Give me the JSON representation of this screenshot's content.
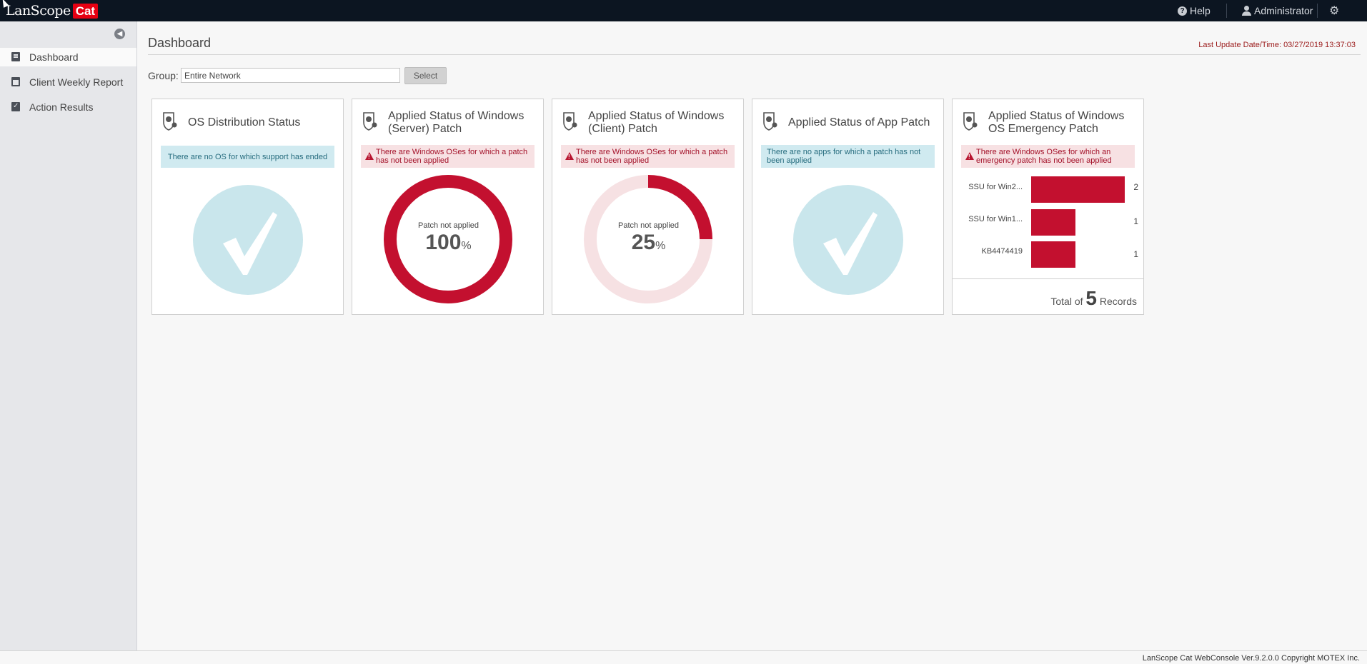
{
  "app": {
    "logo_text": "LanScope",
    "logo_badge": "Cat"
  },
  "topbar": {
    "help_label": "Help",
    "user_label": "Administrator",
    "icons": [
      "help-icon",
      "user-icon",
      "settings-icon"
    ]
  },
  "sidebar": {
    "items": [
      {
        "label": "Dashboard",
        "icon": "dashboard-icon",
        "active": true
      },
      {
        "label": "Client Weekly Report",
        "icon": "calendar-icon",
        "active": false
      },
      {
        "label": "Action Results",
        "icon": "clipboard-check-icon",
        "active": false
      }
    ]
  },
  "page": {
    "title": "Dashboard",
    "last_update": "Last Update Date/Time: 03/27/2019 13:37:03",
    "group_label": "Group:",
    "group_value": "Entire Network",
    "select_label": "Select"
  },
  "cards": [
    {
      "title": "OS Distribution Status",
      "alert": "There are no OS for which support has ended",
      "alert_type": "info"
    },
    {
      "title": "Applied Status of Windows (Server) Patch",
      "alert": "There are Windows OSes for which a patch has not been applied",
      "alert_type": "warning",
      "donut_label": "Patch not applied",
      "donut_value": "100",
      "donut_unit": "%",
      "donut_fraction": 1.0
    },
    {
      "title": "Applied Status of Windows (Client) Patch",
      "alert": "There are Windows OSes for which a patch has not been applied",
      "alert_type": "warning",
      "donut_label": "Patch not applied",
      "donut_value": "25",
      "donut_unit": "%",
      "donut_fraction": 0.25
    },
    {
      "title": "Applied Status of App Patch",
      "alert": "There are no apps for which a patch has not been applied",
      "alert_type": "info"
    },
    {
      "title": "Applied Status of Windows OS Emergency Patch",
      "alert": "There are Windows OSes for which an emergency patch has not been applied",
      "alert_type": "warning",
      "bars": [
        {
          "label": "SSU for Win2...",
          "value": 2
        },
        {
          "label": "SSU for Win1...",
          "value": 1
        },
        {
          "label": "KB4474419",
          "value": 1
        }
      ],
      "total_prefix": "Total of",
      "total_value": "5",
      "total_suffix": "Records"
    }
  ],
  "colors": {
    "accent_red": "#c3102f",
    "info_bg": "#d0eaf0",
    "warn_bg": "#f7e1e3",
    "check_bg": "#c9e6ec",
    "topbar": "#0c1521"
  },
  "footer": {
    "text": "LanScope Cat WebConsole Ver.9.2.0.0 Copyright MOTEX Inc."
  }
}
